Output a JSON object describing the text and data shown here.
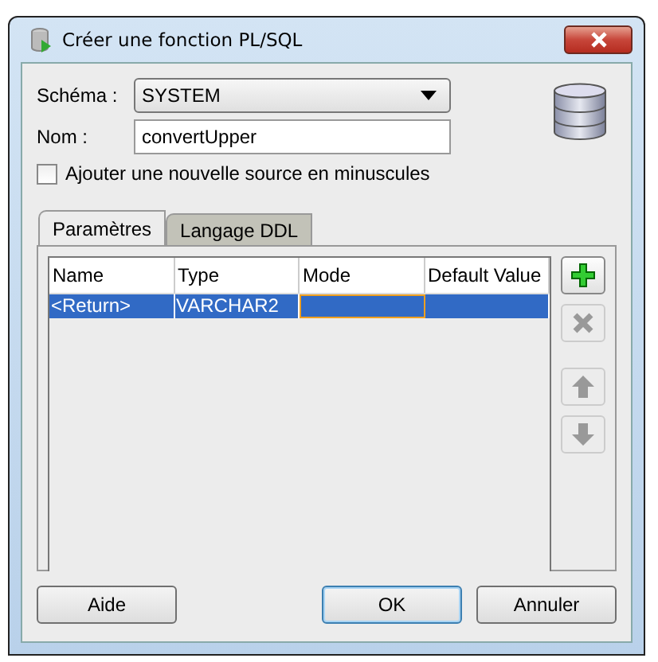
{
  "window": {
    "title": "Créer une fonction PL/SQL"
  },
  "schema": {
    "label": "Schéma :",
    "value": "SYSTEM"
  },
  "name": {
    "label": "Nom :",
    "value": "convertUpper"
  },
  "lowercase": {
    "label": "Ajouter une nouvelle source en minuscules",
    "checked": false
  },
  "tabs": [
    {
      "label": "Paramètres",
      "selected": true
    },
    {
      "label": "Langage DDL",
      "selected": false
    }
  ],
  "table": {
    "columns": [
      "Name",
      "Type",
      "Mode",
      "Default Value"
    ],
    "rows": [
      {
        "cells": [
          "<Return>",
          "VARCHAR2",
          "",
          ""
        ],
        "selected": true
      }
    ]
  },
  "side_buttons": [
    {
      "kind": "add",
      "disabled": false
    },
    {
      "kind": "remove",
      "disabled": true
    },
    {
      "kind": "up",
      "disabled": true
    },
    {
      "kind": "down",
      "disabled": true
    }
  ],
  "buttons": [
    {
      "label": "Aide",
      "default": false
    },
    {
      "label": "OK",
      "default": true
    },
    {
      "label": "Annuler",
      "default": false
    }
  ]
}
